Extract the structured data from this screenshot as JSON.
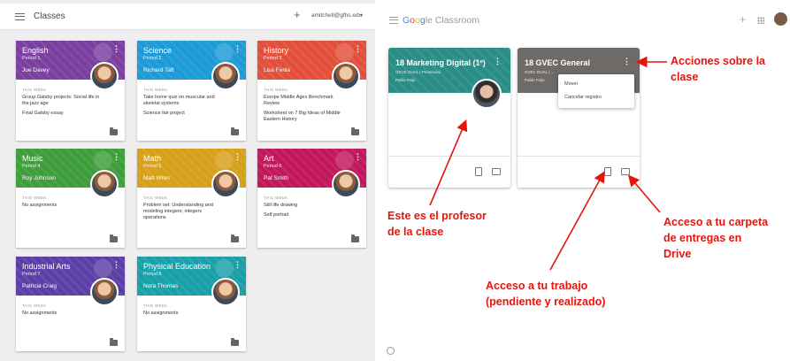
{
  "left": {
    "header": {
      "title": "Classes",
      "plus_icon": "+",
      "account": "amitchell@gfhs.edu",
      "caret_icon": "▾"
    },
    "this_week_label": "THIS WEEK",
    "classes": [
      {
        "name": "English",
        "period": "Period 1",
        "teacher": "Joe Davey",
        "color": "#7b3fa0",
        "items": [
          "Group Gatsby projects: Social life in the jazz age",
          "Final Gatsby essay"
        ]
      },
      {
        "name": "Science",
        "period": "Period 2",
        "teacher": "Richard Taft",
        "color": "#1e9ad6",
        "items": [
          "Take home quiz on muscular and skeletal systems",
          "Science fair project"
        ]
      },
      {
        "name": "History",
        "period": "Period 3",
        "teacher": "Lisa Fenla",
        "color": "#e2503c",
        "items": [
          "Europe Middle Ages Benchmark Review",
          "Worksheet on 7 Big Ideas of Middle Eastern History"
        ]
      },
      {
        "name": "Music",
        "period": "Period 4",
        "teacher": "Roy Johnson",
        "color": "#3f9d3c",
        "items": [
          "No assignments"
        ]
      },
      {
        "name": "Math",
        "period": "Period 5",
        "teacher": "Matt Wren",
        "color": "#d6a01a",
        "items": [
          "Problem set: Understanding and modeling integers; integers operations"
        ]
      },
      {
        "name": "Art",
        "period": "Period 6",
        "teacher": "Pat Smith",
        "color": "#c2185b",
        "items": [
          "Still life drawing",
          "Self portrait"
        ]
      },
      {
        "name": "Industrial Arts",
        "period": "Period 7",
        "teacher": "Patricia Craig",
        "color": "#5b3fa6",
        "items": [
          "No assignments"
        ]
      },
      {
        "name": "Physical Education",
        "period": "Period 8",
        "teacher": "Nora Thomas",
        "color": "#1aa0a8",
        "items": [
          "No assignments"
        ]
      }
    ]
  },
  "right": {
    "logo": {
      "g1": "G",
      "g2": "o",
      "g3": "o",
      "g4": "g",
      "rest": "le Classroom"
    },
    "plus_icon": "+",
    "cards": [
      {
        "title": "18 Marketing Digital (1º)",
        "subtitle": "GRUE DUAL | Presencial",
        "teacher": "Pablo Feijo",
        "color": "#2a8d86"
      },
      {
        "title": "18 GVEC General",
        "subtitle": "GVEC DUAL | ...",
        "teacher": "Pablo Feijo",
        "color": "#6e6a67"
      }
    ],
    "dropdown": [
      "Mover",
      "Cancelar registro"
    ],
    "annotations": {
      "acciones": [
        "Acciones sobre la",
        "clase"
      ],
      "profesor": [
        "Este es el profesor",
        "de la clase"
      ],
      "carpeta": [
        "Acceso a tu carpeta",
        "de entregas en",
        "Drive"
      ],
      "trabajo": [
        "Acceso a tu trabajo",
        "(pendiente y realizado)"
      ]
    },
    "footer_icon": "?"
  }
}
